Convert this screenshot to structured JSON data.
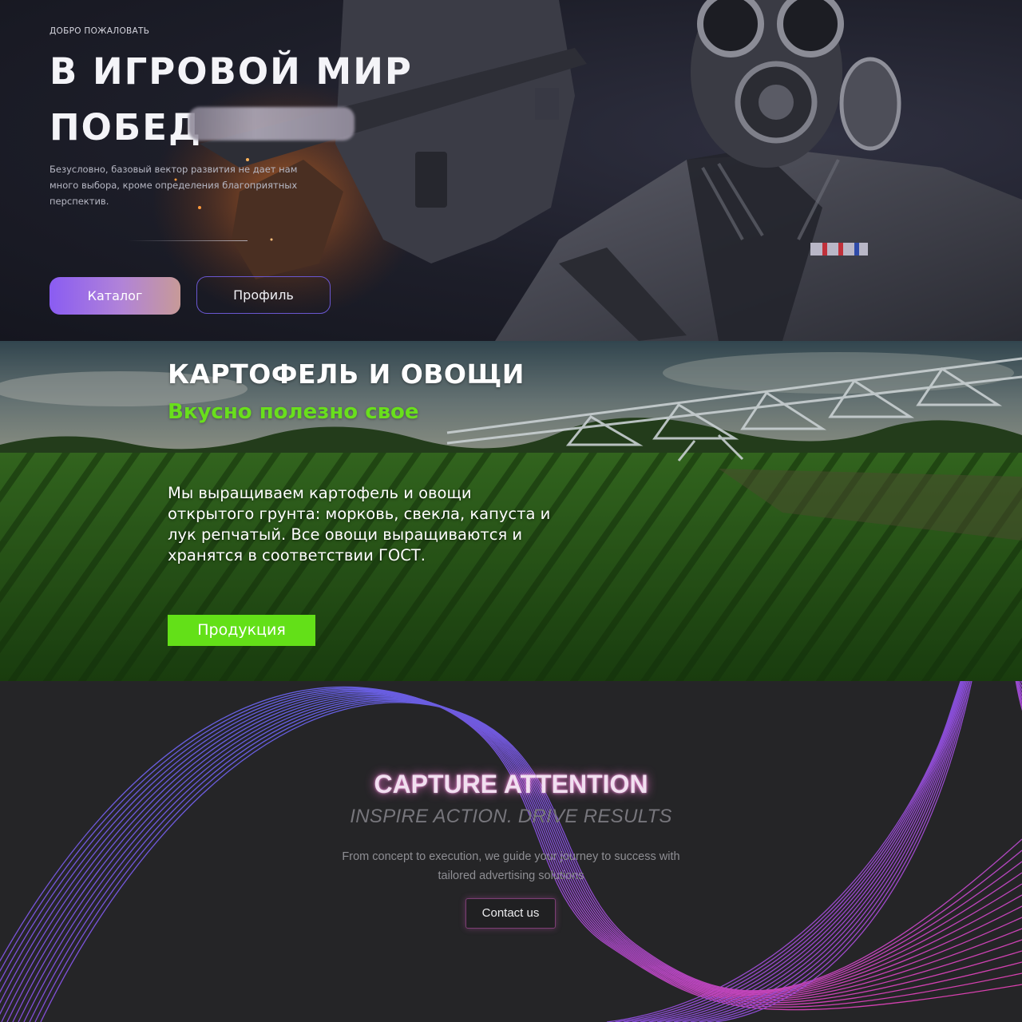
{
  "gaming_banner": {
    "eyebrow": "ДОБРО ПОЖАЛОВАТЬ",
    "title_line1": "В ИГРОВОЙ МИР",
    "title_line2": "ПОБЕД",
    "description": "Безусловно, базовый вектор развития не дает нам много выбора, кроме определения благоприятных перспектив.",
    "catalog_button": "Каталог",
    "profile_button": "Профиль",
    "colors": {
      "accent_start": "#8a5cf2",
      "accent_end": "#c79a98",
      "outline": "#6a57d1"
    }
  },
  "farm_banner": {
    "title": "КАРТОФЕЛЬ И ОВОЩИ",
    "tagline": "Вкусно полезно свое",
    "description": "Мы выращиваем картофель и овощи открытого грунта: морковь, свекла, капуста и лук репчатый. Все овощи выращиваются и хранятся в соответствии ГОСТ.",
    "products_button": "Продукция",
    "colors": {
      "accent": "#63e018"
    }
  },
  "ads_banner": {
    "headline": "CAPTURE ATTENTION",
    "subheadline": "INSPIRE ACTION. DRIVE RESULTS",
    "body": "From concept to execution, we guide your journey to success with tailored advertising solutions",
    "contact_button": "Contact us",
    "colors": {
      "wave_blue": "#5a6cf0",
      "wave_pink": "#f040b0",
      "glow": "#ff78dc"
    }
  }
}
